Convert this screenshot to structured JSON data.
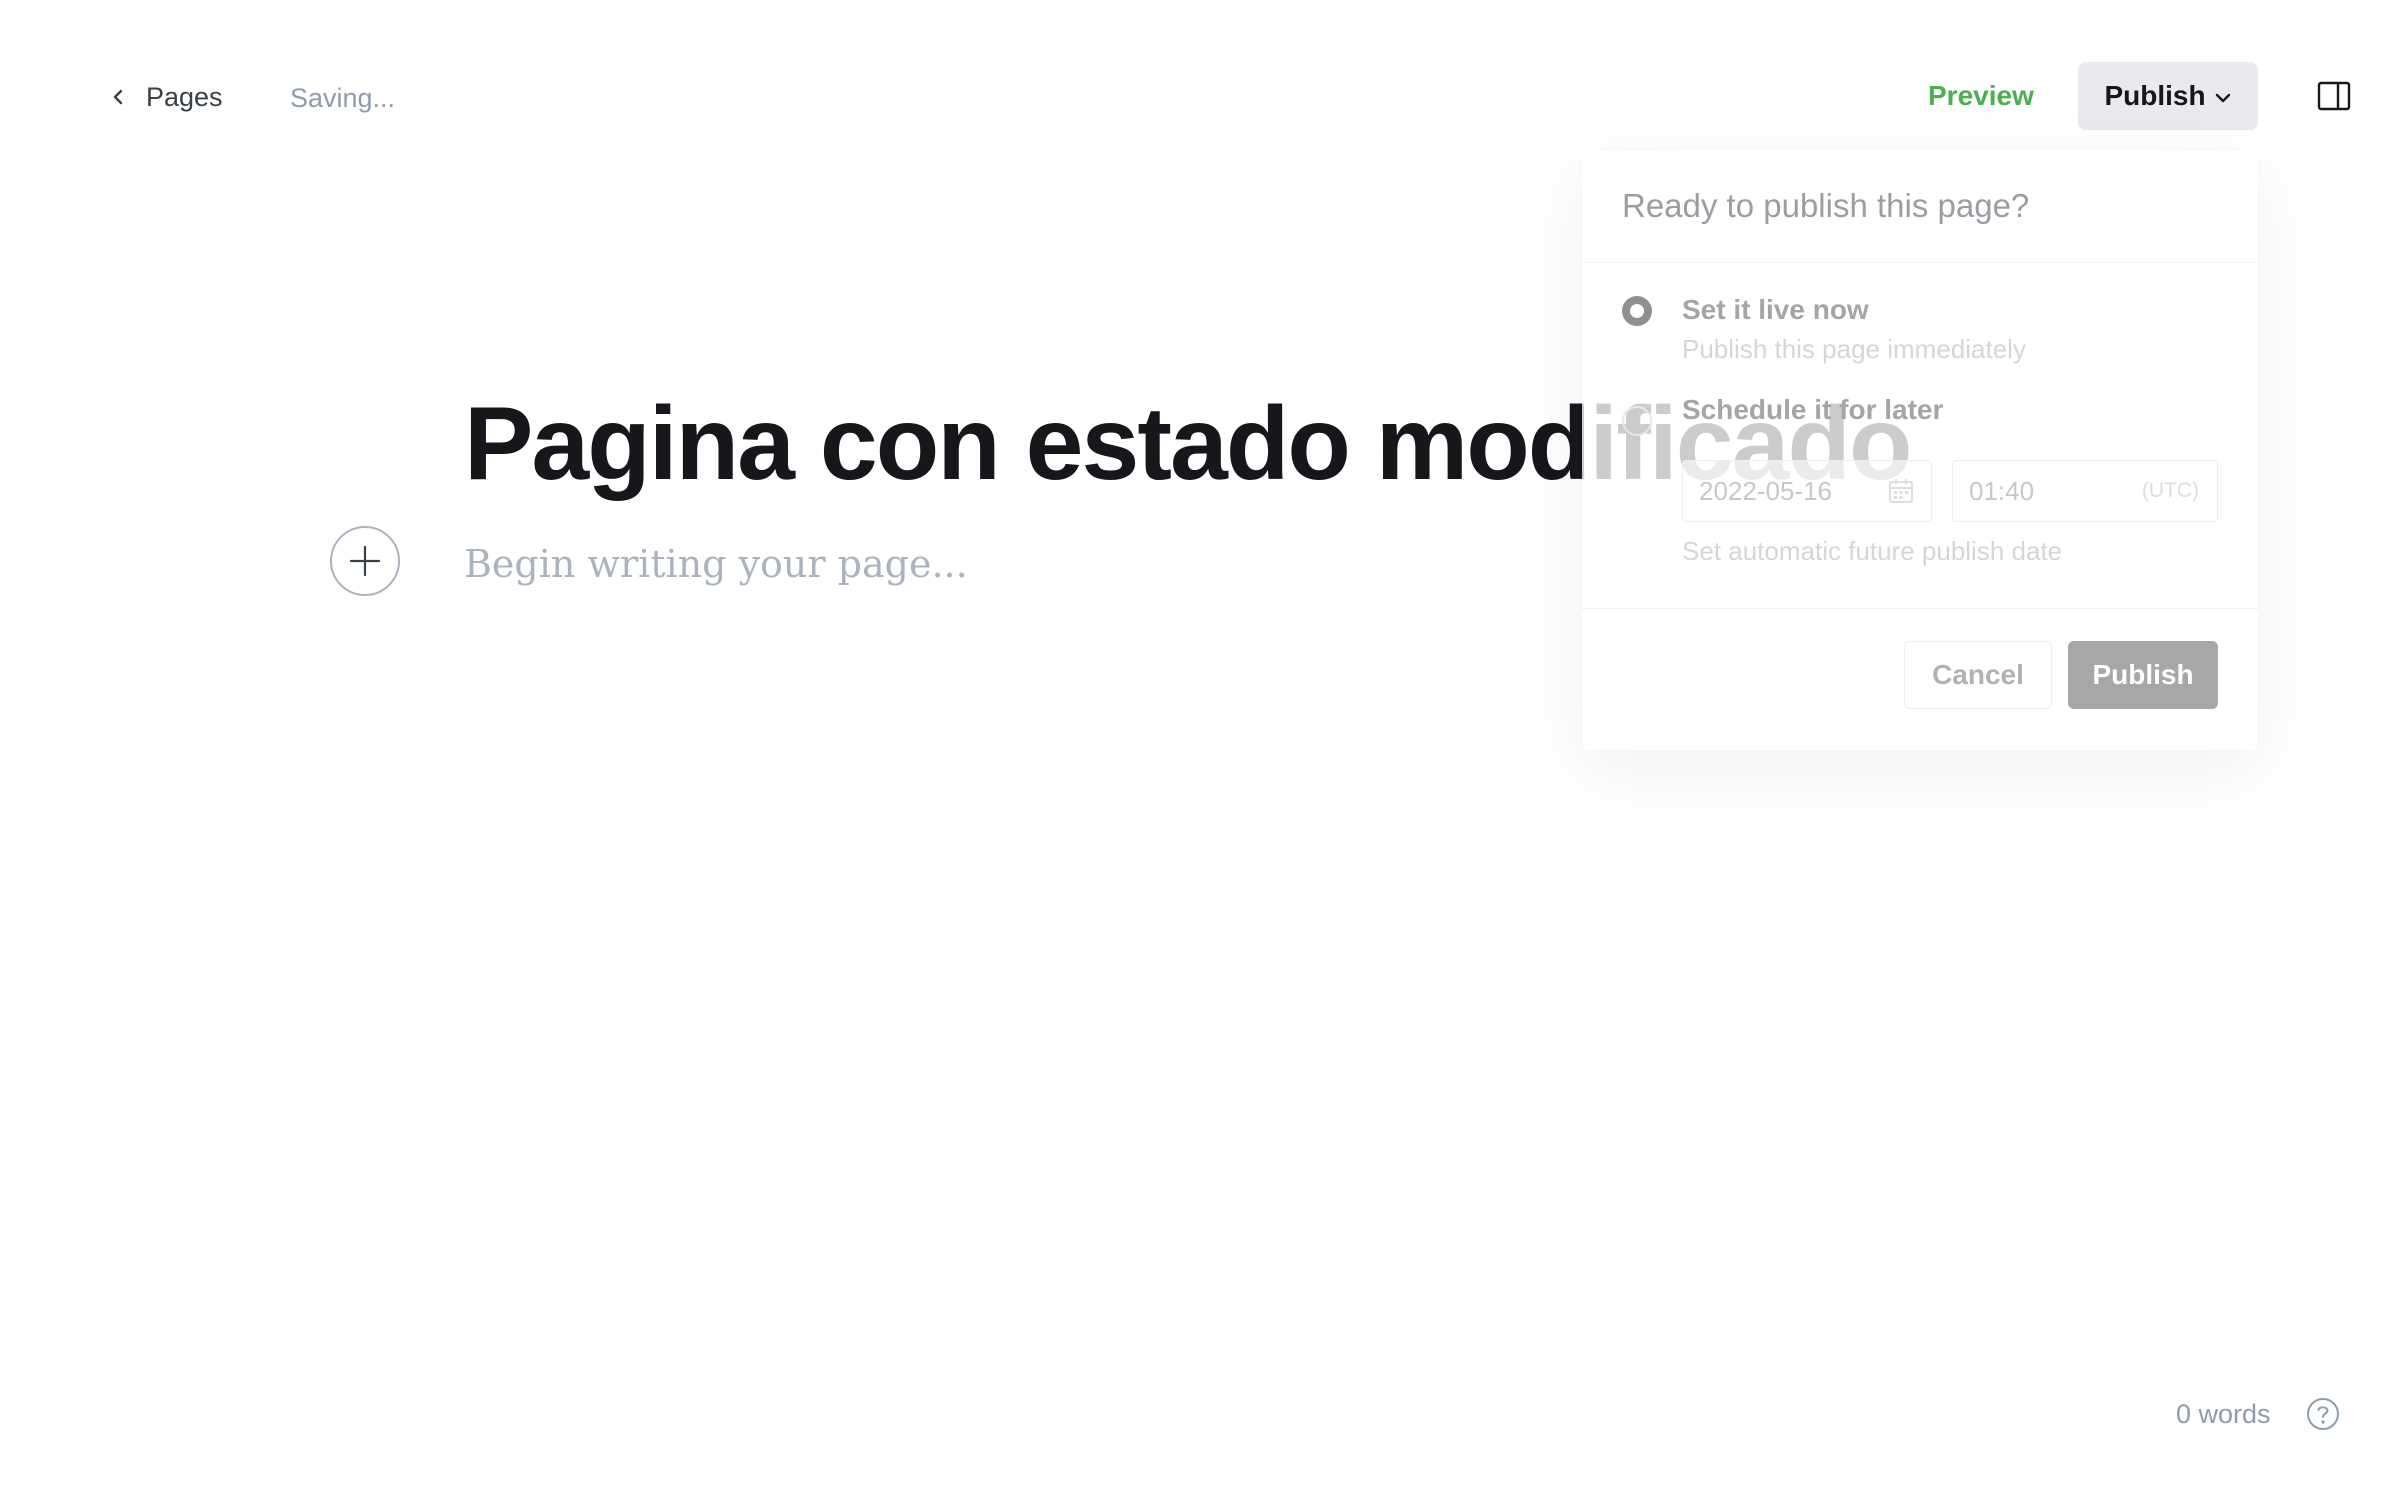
{
  "header": {
    "back_label": "Pages",
    "save_status": "Saving...",
    "preview_label": "Preview",
    "publish_label": "Publish"
  },
  "editor": {
    "title": "Pagina con estado modificado",
    "body_placeholder": "Begin writing your page..."
  },
  "publish_menu": {
    "heading": "Ready to publish this page?",
    "options": [
      {
        "label": "Set it live now",
        "description": "Publish this page immediately",
        "selected": true
      },
      {
        "label": "Schedule it for later",
        "description": "Set automatic future publish date",
        "selected": false
      }
    ],
    "date_value": "2022-05-16",
    "time_value": "01:40",
    "timezone": "(UTC)",
    "cancel_label": "Cancel",
    "publish_label": "Publish"
  },
  "footer": {
    "word_count": "0 words"
  },
  "colors": {
    "preview_green": "#4cb050",
    "title_text": "#15171a",
    "muted_text": "#8e9cac"
  },
  "icons": [
    "chevron-left-icon",
    "chevron-down-icon",
    "sidebar-toggle-icon",
    "plus-icon",
    "calendar-icon",
    "help-icon"
  ]
}
